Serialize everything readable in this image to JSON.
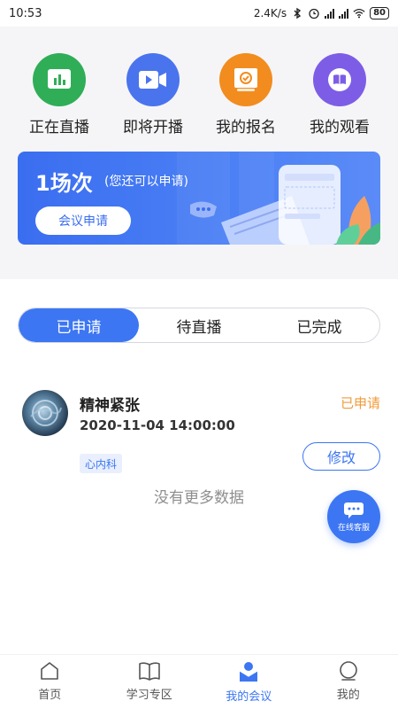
{
  "status_bar": {
    "time": "10:53",
    "speed": "2.4K/s",
    "battery": "80"
  },
  "quick_nav": [
    {
      "label": "正在直播",
      "icon": "live-chart-icon",
      "color": "#2fae57"
    },
    {
      "label": "即将开播",
      "icon": "video-camera-icon",
      "color": "#4a74ee"
    },
    {
      "label": "我的报名",
      "icon": "signup-check-icon",
      "color": "#f28c1f"
    },
    {
      "label": "我的观看",
      "icon": "book-icon",
      "color": "#7d5de6"
    }
  ],
  "banner": {
    "title": "1场次",
    "subtitle": "(您还可以申请)",
    "button": "会议申请"
  },
  "tabs": [
    {
      "label": "已申请",
      "active": true
    },
    {
      "label": "待直播",
      "active": false
    },
    {
      "label": "已完成",
      "active": false
    }
  ],
  "list": [
    {
      "title": "精神紧张",
      "time": "2020-11-04 14:00:00",
      "status": "已申请",
      "tag": "心内科",
      "action": "修改"
    }
  ],
  "no_more_text": "没有更多数据",
  "fab_label": "在线客服",
  "bottom_nav": [
    {
      "label": "首页",
      "icon": "home-icon",
      "active": false
    },
    {
      "label": "学习专区",
      "icon": "open-book-icon",
      "active": false
    },
    {
      "label": "我的会议",
      "icon": "meeting-icon",
      "active": true
    },
    {
      "label": "我的",
      "icon": "profile-icon",
      "active": false
    }
  ],
  "colors": {
    "accent": "#3c76f3",
    "status_orange": "#f29a38"
  }
}
